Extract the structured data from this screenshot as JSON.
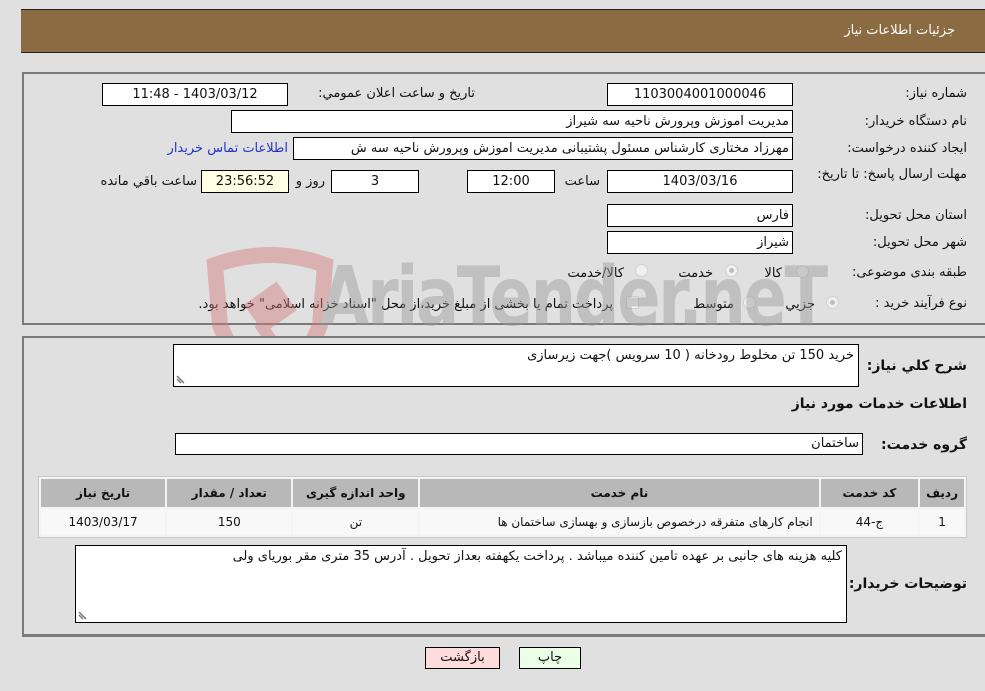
{
  "header": {
    "title": "جزئیات اطلاعات نیاز"
  },
  "details": {
    "need_number_label": "شماره نیاز:",
    "need_number": "1103004001000046",
    "announce_label": "تاریخ و ساعت اعلان عمومي:",
    "announce_value": "1403/03/12 - 11:48",
    "buyer_org_label": "نام دستگاه خریدار:",
    "buyer_org": "مدیریت اموزش وپرورش ناحیه سه شیراز",
    "creator_label": "ایجاد کننده درخواست:",
    "creator": "مهرزاد مختاری کارشناس مسئول پشتیبانی مدیریت اموزش وپرورش ناحیه سه ش",
    "contact_link": "اطلاعات تماس خریدار",
    "deadline_label": "مهلت ارسال پاسخ: تا تاریخ:",
    "deadline_date": "1403/03/16",
    "time_label": "ساعت",
    "deadline_time": "12:00",
    "days_value": "3",
    "days_label": "روز و",
    "remaining_time": "23:56:52",
    "remaining_label": "ساعت باقي مانده",
    "province_label": "استان محل تحویل:",
    "province": "فارس",
    "city_label": "شهر محل تحویل:",
    "city": "شیراز",
    "category_label": "طبقه بندی موضوعی:",
    "category_options": [
      "کالا",
      "خدمت",
      "کالا/خدمت"
    ],
    "category_selected": "خدمت",
    "process_label": "نوع فرآیند خرید :",
    "process_options": [
      "جزيي",
      "متوسط"
    ],
    "process_selected": "جزيي",
    "treasury_note": "پرداخت تمام یا بخشی از مبلغ خرید،از محل \"اسناد خزانه اسلامی\" خواهد بود."
  },
  "summary": {
    "description_label": "شرح کلي نياز:",
    "description": "خرید 150 تن مخلوط رودخانه ( 10 سرویس )جهت زیرسازی",
    "services_heading": "اطلاعات خدمات مورد نياز",
    "service_group_label": "گروه خدمت:",
    "service_group": "ساختمان"
  },
  "table": {
    "columns": [
      "ردیف",
      "کد خدمت",
      "نام خدمت",
      "واحد اندازه گیری",
      "تعداد / مقدار",
      "تاریخ نیاز"
    ],
    "rows": [
      [
        "1",
        "ج-44",
        "انجام کارهای متفرقه درخصوص بازسازی و بهسازی ساختمان ها",
        "تن",
        "150",
        "1403/03/17"
      ]
    ]
  },
  "notes": {
    "label": "توضیحات خریدار:",
    "text": "کلیه هزینه های جانبی بر عهده تامین کننده میباشد . پرداخت یکهفته بعداز تحویل . آدرس 35 متری مقر بوریای ولی"
  },
  "buttons": {
    "print": "چاپ",
    "back": "بازگشت"
  },
  "watermark": {
    "text": "AriaTender.neT"
  },
  "colors": {
    "header_bg": "#8b6b42",
    "link": "#2233cc",
    "back_btn": "#ffdcdc",
    "print_btn": "#ebffe6"
  }
}
